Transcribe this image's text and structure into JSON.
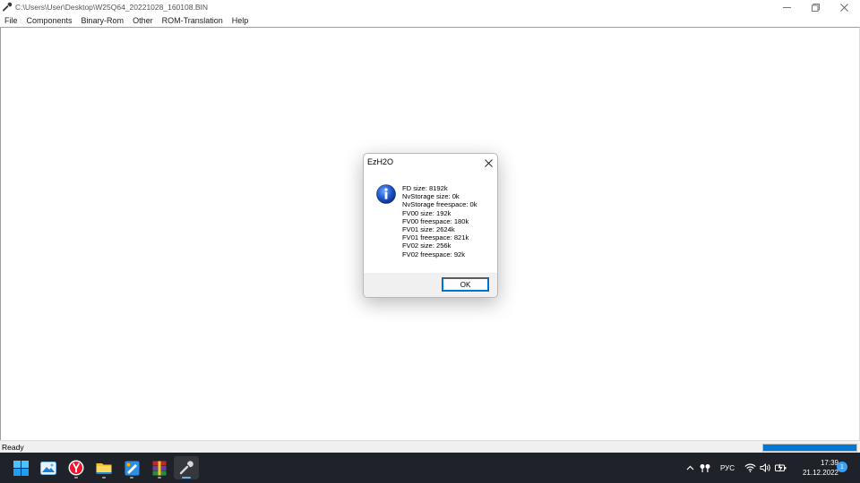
{
  "window": {
    "title": "C:\\Users\\User\\Desktop\\W25Q64_20221028_160108.BIN",
    "icon": "wrench-icon",
    "minimize_icon": "minimize-icon",
    "restore_icon": "restore-icon",
    "close_icon": "close-icon"
  },
  "menu": {
    "items": [
      {
        "label": "File"
      },
      {
        "label": "Components"
      },
      {
        "label": "Binary-Rom"
      },
      {
        "label": "Other"
      },
      {
        "label": "ROM-Translation"
      },
      {
        "label": "Help"
      }
    ]
  },
  "statusbar": {
    "text": "Ready",
    "progress": 1.0,
    "progress_color": "#0078d7"
  },
  "dialog": {
    "title": "EzH2O",
    "icon": "info-icon",
    "lines": [
      "FD size: 8192k",
      "NvStorage size: 0k",
      "NvStorage freespace: 0k",
      "FV00 size: 192k",
      "FV00 freespace: 180k",
      "FV01 size: 2624k",
      "FV01 freespace: 821k",
      "FV02 size: 256k",
      "FV02 freespace: 92k"
    ],
    "ok_label": "OK"
  },
  "taskbar": {
    "apps": [
      {
        "name": "start-icon"
      },
      {
        "name": "photos-icon"
      },
      {
        "name": "yandex-browser-icon"
      },
      {
        "name": "file-explorer-icon"
      },
      {
        "name": "paint-icon"
      },
      {
        "name": "winrar-icon"
      },
      {
        "name": "ezh2o-wrench-icon"
      }
    ],
    "tray": {
      "language": "РУС",
      "time": "17:39",
      "date": "21.12.2022",
      "notifications": "1"
    }
  }
}
